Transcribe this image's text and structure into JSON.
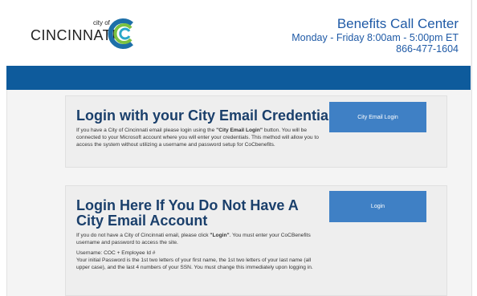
{
  "header": {
    "logo_city_of": "city of",
    "logo_text": "CINCINNATI",
    "call_center_title": "Benefits Call Center",
    "hours": "Monday - Friday 8:00am - 5:00pm ET",
    "phone": "866-477-1604"
  },
  "card1": {
    "title": "Login with your City Email Credentials",
    "text_before": "If you have a City of Cincinnati email please login using the ",
    "text_bold": "\"City Email Login\"",
    "text_after": " button. You will be connected to your Microsoft account where you will enter your credentials. This method will allow you to access the system without utilizing a username and password setup for CoCbenefits.",
    "button_label": "City Email Login"
  },
  "card2": {
    "title": "Login Here If You Do Not Have A City Email Account",
    "text_before": "If you do not have a City of Cincinnati email, please click ",
    "text_bold": "\"Login\"",
    "text_after": ". You must enter your CoCBenefits username and password to access the site.",
    "username_line": "Username: COC + Employee Id #",
    "password_line": "Your initial Password is the 1st two letters of your first name, the 1st two letters of your last name (all upper case), and the last 4 numbers of your SSN. You must change this immediately upon logging in.",
    "button_label": "Login"
  },
  "colors": {
    "brand_blue": "#0e5b9c",
    "button_blue": "#3f80c5",
    "heading_navy": "#1a3f6b"
  }
}
